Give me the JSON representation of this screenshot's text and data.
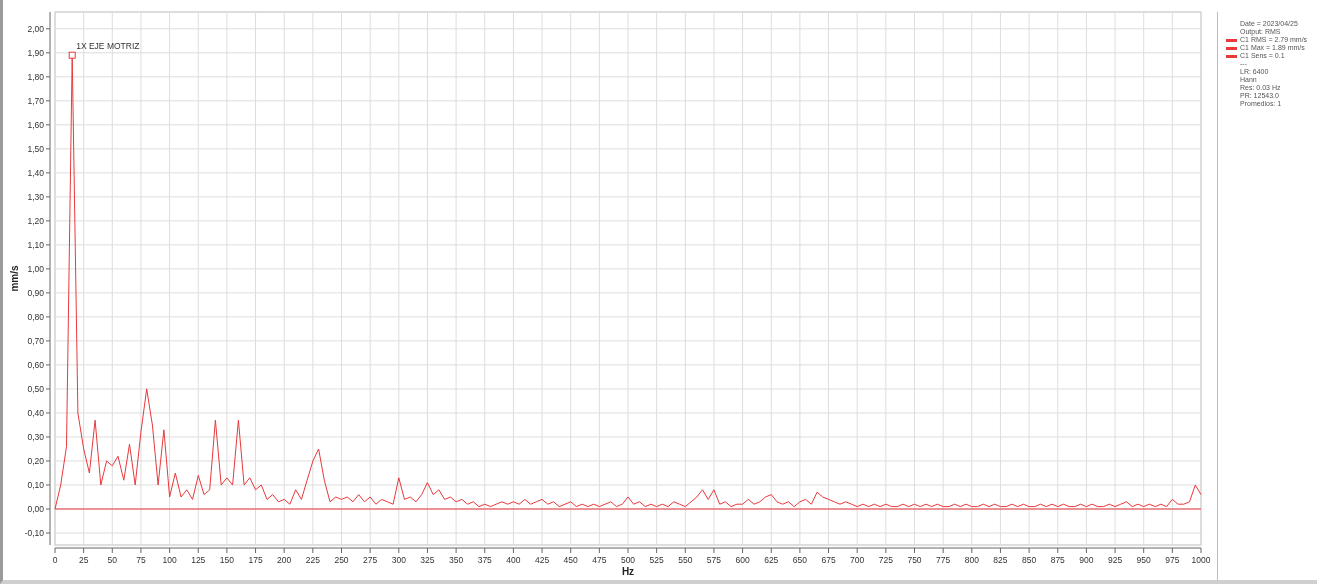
{
  "chart": {
    "chart_data": {
      "type": "line",
      "xlabel": "Hz",
      "ylabel": "mm/s",
      "grid": true,
      "ref_lines": [
        {
          "axis": "y",
          "value": 0,
          "color": "#e8393c"
        }
      ],
      "xlim": [
        0,
        1000
      ],
      "ylim": [
        -0.15,
        2.07
      ],
      "xticks": [
        0,
        25,
        50,
        75,
        100,
        125,
        150,
        175,
        200,
        225,
        250,
        275,
        300,
        325,
        350,
        375,
        400,
        425,
        450,
        475,
        500,
        525,
        550,
        575,
        600,
        625,
        650,
        675,
        700,
        725,
        750,
        775,
        800,
        825,
        850,
        875,
        900,
        925,
        950,
        975,
        1000
      ],
      "yticks": [
        {
          "value": -0.1,
          "label": "-0,10"
        },
        {
          "value": 0,
          "label": "0,00"
        },
        {
          "value": 0.1,
          "label": "0,10"
        },
        {
          "value": 0.2,
          "label": "0,20"
        },
        {
          "value": 0.3,
          "label": "0,30"
        },
        {
          "value": 0.4,
          "label": "0,40"
        },
        {
          "value": 0.5,
          "label": "0,50"
        },
        {
          "value": 0.6,
          "label": "0,60"
        },
        {
          "value": 0.7,
          "label": "0,70"
        },
        {
          "value": 0.8,
          "label": "0,80"
        },
        {
          "value": 0.9,
          "label": "0,90"
        },
        {
          "value": 1.0,
          "label": "1,00"
        },
        {
          "value": 1.1,
          "label": "1,10"
        },
        {
          "value": 1.2,
          "label": "1,20"
        },
        {
          "value": 1.3,
          "label": "1,30"
        },
        {
          "value": 1.4,
          "label": "1,40"
        },
        {
          "value": 1.5,
          "label": "1,50"
        },
        {
          "value": 1.6,
          "label": "1,60"
        },
        {
          "value": 1.7,
          "label": "1,70"
        },
        {
          "value": 1.8,
          "label": "1,80"
        },
        {
          "value": 1.9,
          "label": "1,90"
        },
        {
          "value": 2.0,
          "label": "2,00"
        }
      ],
      "x": [
        0,
        5,
        10,
        15,
        20,
        25,
        30,
        35,
        40,
        45,
        50,
        55,
        60,
        65,
        70,
        75,
        80,
        85,
        90,
        95,
        100,
        105,
        110,
        115,
        120,
        125,
        130,
        135,
        140,
        145,
        150,
        155,
        160,
        165,
        170,
        175,
        180,
        185,
        190,
        195,
        200,
        205,
        210,
        215,
        220,
        225,
        230,
        235,
        240,
        245,
        250,
        255,
        260,
        265,
        270,
        275,
        280,
        285,
        290,
        295,
        300,
        305,
        310,
        315,
        320,
        325,
        330,
        335,
        340,
        345,
        350,
        355,
        360,
        365,
        370,
        375,
        380,
        385,
        390,
        395,
        400,
        405,
        410,
        415,
        420,
        425,
        430,
        435,
        440,
        445,
        450,
        455,
        460,
        465,
        470,
        475,
        480,
        485,
        490,
        495,
        500,
        505,
        510,
        515,
        520,
        525,
        530,
        535,
        540,
        545,
        550,
        555,
        560,
        565,
        570,
        575,
        580,
        585,
        590,
        595,
        600,
        605,
        610,
        615,
        620,
        625,
        630,
        635,
        640,
        645,
        650,
        655,
        660,
        665,
        670,
        675,
        680,
        685,
        690,
        695,
        700,
        705,
        710,
        715,
        720,
        725,
        730,
        735,
        740,
        745,
        750,
        755,
        760,
        765,
        770,
        775,
        780,
        785,
        790,
        795,
        800,
        805,
        810,
        815,
        820,
        825,
        830,
        835,
        840,
        845,
        850,
        855,
        860,
        865,
        870,
        875,
        880,
        885,
        890,
        895,
        900,
        905,
        910,
        915,
        920,
        925,
        930,
        935,
        940,
        945,
        950,
        955,
        960,
        965,
        970,
        975,
        980,
        985,
        990,
        995,
        1000
      ],
      "series": [
        {
          "color": "#e8393c",
          "values": [
            0,
            0.1,
            0.26,
            1.89,
            0.4,
            0.25,
            0.15,
            0.37,
            0.1,
            0.2,
            0.18,
            0.22,
            0.12,
            0.27,
            0.1,
            0.32,
            0.5,
            0.35,
            0.1,
            0.33,
            0.05,
            0.15,
            0.05,
            0.08,
            0.04,
            0.14,
            0.06,
            0.08,
            0.37,
            0.1,
            0.13,
            0.1,
            0.37,
            0.1,
            0.13,
            0.08,
            0.1,
            0.04,
            0.06,
            0.03,
            0.04,
            0.02,
            0.08,
            0.04,
            0.12,
            0.2,
            0.25,
            0.12,
            0.03,
            0.05,
            0.04,
            0.05,
            0.03,
            0.06,
            0.03,
            0.05,
            0.02,
            0.04,
            0.03,
            0.02,
            0.13,
            0.04,
            0.05,
            0.03,
            0.06,
            0.11,
            0.06,
            0.08,
            0.04,
            0.05,
            0.03,
            0.04,
            0.02,
            0.03,
            0.01,
            0.02,
            0.01,
            0.02,
            0.03,
            0.02,
            0.03,
            0.02,
            0.04,
            0.02,
            0.03,
            0.04,
            0.02,
            0.03,
            0.01,
            0.02,
            0.03,
            0.01,
            0.02,
            0.01,
            0.02,
            0.01,
            0.02,
            0.03,
            0.01,
            0.02,
            0.05,
            0.02,
            0.03,
            0.01,
            0.02,
            0.01,
            0.02,
            0.01,
            0.03,
            0.02,
            0.01,
            0.03,
            0.05,
            0.08,
            0.04,
            0.08,
            0.02,
            0.03,
            0.01,
            0.02,
            0.02,
            0.04,
            0.02,
            0.03,
            0.05,
            0.06,
            0.03,
            0.02,
            0.03,
            0.01,
            0.03,
            0.04,
            0.02,
            0.07,
            0.05,
            0.04,
            0.03,
            0.02,
            0.03,
            0.02,
            0.01,
            0.02,
            0.01,
            0.02,
            0.01,
            0.02,
            0.01,
            0.01,
            0.02,
            0.01,
            0.02,
            0.01,
            0.02,
            0.01,
            0.02,
            0.01,
            0.01,
            0.02,
            0.01,
            0.02,
            0.01,
            0.01,
            0.02,
            0.01,
            0.02,
            0.01,
            0.01,
            0.02,
            0.01,
            0.02,
            0.01,
            0.01,
            0.02,
            0.01,
            0.02,
            0.01,
            0.02,
            0.01,
            0.01,
            0.02,
            0.01,
            0.02,
            0.01,
            0.01,
            0.02,
            0.01,
            0.02,
            0.03,
            0.01,
            0.02,
            0.01,
            0.02,
            0.01,
            0.02,
            0.01,
            0.04,
            0.02,
            0.02,
            0.03,
            0.1,
            0.06
          ]
        }
      ],
      "annotations": [
        {
          "x": 15,
          "y": 1.89,
          "text": "1X EJE MOTRIZ"
        }
      ]
    }
  },
  "legend": [
    {
      "kind": "info",
      "text": "Date = 2023/04/25"
    },
    {
      "kind": "info",
      "text": "Output: RMS"
    },
    {
      "kind": "series",
      "text": "C1 RMS = 2.79 mm/s"
    },
    {
      "kind": "series",
      "text": "C1 Max = 1.89 mm/s"
    },
    {
      "kind": "series",
      "text": "C1 Sens = 0.1"
    },
    {
      "kind": "info",
      "text": "---"
    },
    {
      "kind": "info",
      "text": "LR: 6400"
    },
    {
      "kind": "info",
      "text": "Hann"
    },
    {
      "kind": "info",
      "text": "Res: 0.03 Hz"
    },
    {
      "kind": "info",
      "text": "PR: 12543.0"
    },
    {
      "kind": "info",
      "text": "Promedios: 1"
    }
  ]
}
